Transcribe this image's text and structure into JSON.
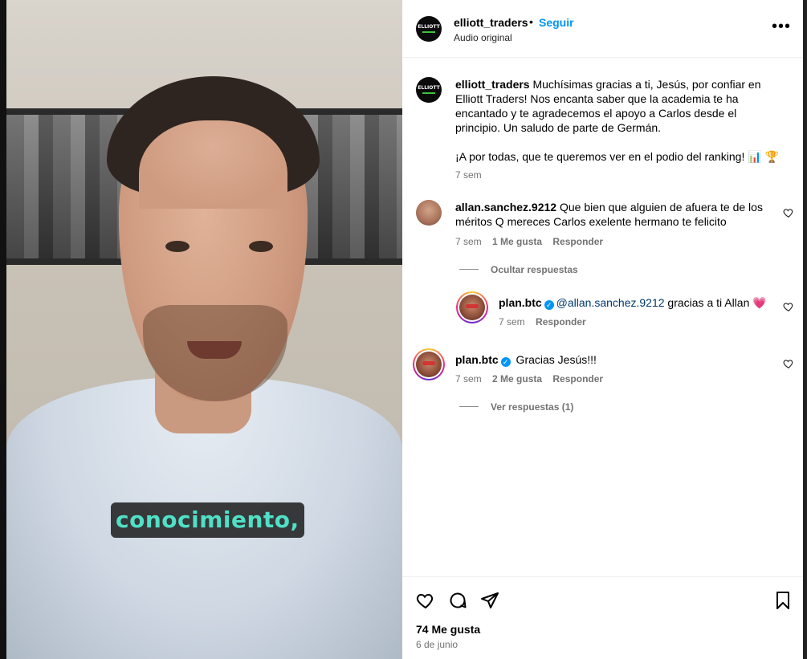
{
  "video": {
    "caption": "conocimiento,"
  },
  "header": {
    "username": "elliott_traders",
    "separator": "•",
    "follow_label": "Seguir",
    "audio_label": "Audio original",
    "more_icon": "more-horizontal-icon",
    "brand_avatar_text": "ELLIOTT"
  },
  "caption_post": {
    "username": "elliott_traders",
    "text": " Muchísimas gracias a ti, Jesús, por confiar en Elliott Traders! Nos encanta saber que la academia te ha encantado y te agradecemos el apoyo a Carlos desde el principio. Un saludo de parte de Germán.",
    "text2": "¡A por todas, que te queremos ver en el podio del ranking! 📊 🏆",
    "time": "7 sem"
  },
  "comments": [
    {
      "username": "allan.sanchez.9212",
      "text": " Que bien que alguien de afuera te de los méritos Q mereces Carlos exelente hermano te felicito",
      "time": "7 sem",
      "likes": "1 Me gusta",
      "reply": "Responder",
      "thread_toggle": "Ocultar respuestas",
      "replies": [
        {
          "username": "plan.btc",
          "mention": "@allan.sanchez.9212",
          "text": " gracias a ti Allan 💗",
          "time": "7 sem",
          "reply": "Responder"
        }
      ]
    },
    {
      "username": "plan.btc",
      "text": " Gracias Jesús!!!",
      "time": "7 sem",
      "likes": "2 Me gusta",
      "reply": "Responder",
      "thread_toggle": "Ver respuestas (1)"
    }
  ],
  "footer": {
    "likes": "74 Me gusta",
    "date": "6 de junio",
    "icons": [
      "heart-icon",
      "comment-icon",
      "share-icon",
      "bookmark-icon"
    ]
  },
  "colors": {
    "accent": "#0095f6",
    "caption_text": "#4fe0c6",
    "muted": "#737373"
  }
}
